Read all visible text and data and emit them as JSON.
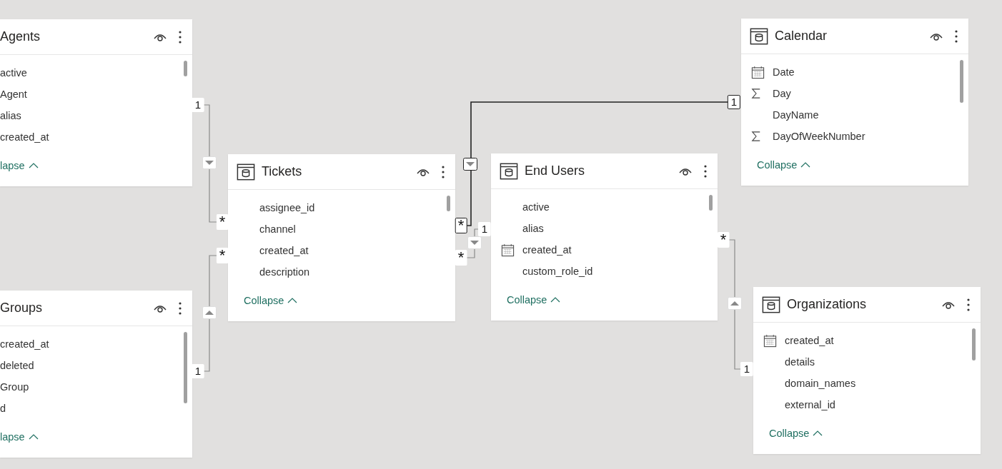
{
  "tables": [
    {
      "title": "Agents",
      "fields": [
        {
          "name": "active"
        },
        {
          "name": "Agent"
        },
        {
          "name": "alias"
        },
        {
          "name": "created_at"
        }
      ],
      "collapse": "lapse"
    },
    {
      "title": "Groups",
      "fields": [
        {
          "name": "created_at"
        },
        {
          "name": "deleted"
        },
        {
          "name": "Group"
        },
        {
          "name": "d"
        }
      ],
      "collapse": "lapse"
    },
    {
      "title": "Tickets",
      "fields": [
        {
          "name": "assignee_id",
          "kind": "text"
        },
        {
          "name": "channel",
          "kind": "text"
        },
        {
          "name": "created_at",
          "kind": "text"
        },
        {
          "name": "description",
          "kind": "text"
        }
      ],
      "collapse": "Collapse"
    },
    {
      "title": "End Users",
      "fields": [
        {
          "name": "active",
          "kind": "text"
        },
        {
          "name": "alias",
          "kind": "text"
        },
        {
          "name": "created_at",
          "kind": "date"
        },
        {
          "name": "custom_role_id",
          "kind": "text"
        }
      ],
      "collapse": "Collapse"
    },
    {
      "title": "Calendar",
      "fields": [
        {
          "name": "Date",
          "kind": "date"
        },
        {
          "name": "Day",
          "kind": "sum"
        },
        {
          "name": "DayName",
          "kind": "text"
        },
        {
          "name": "DayOfWeekNumber",
          "kind": "sum"
        }
      ],
      "collapse": "Collapse"
    },
    {
      "title": "Organizations",
      "fields": [
        {
          "name": "created_at",
          "kind": "date"
        },
        {
          "name": "details",
          "kind": "text"
        },
        {
          "name": "domain_names",
          "kind": "text"
        },
        {
          "name": "external_id",
          "kind": "text"
        }
      ],
      "collapse": "Collapse"
    }
  ],
  "relationships": [
    {
      "one": "1",
      "many": "*",
      "kind": "down",
      "selected": false
    },
    {
      "one": "1",
      "many": "*",
      "kind": "up",
      "selected": false
    },
    {
      "one": "1",
      "many": "*",
      "kind": "down",
      "selected": true
    },
    {
      "one": "1",
      "many": "*",
      "kind": "down",
      "selected": false
    },
    {
      "one": "1",
      "many": "*",
      "kind": "up",
      "selected": false
    }
  ]
}
